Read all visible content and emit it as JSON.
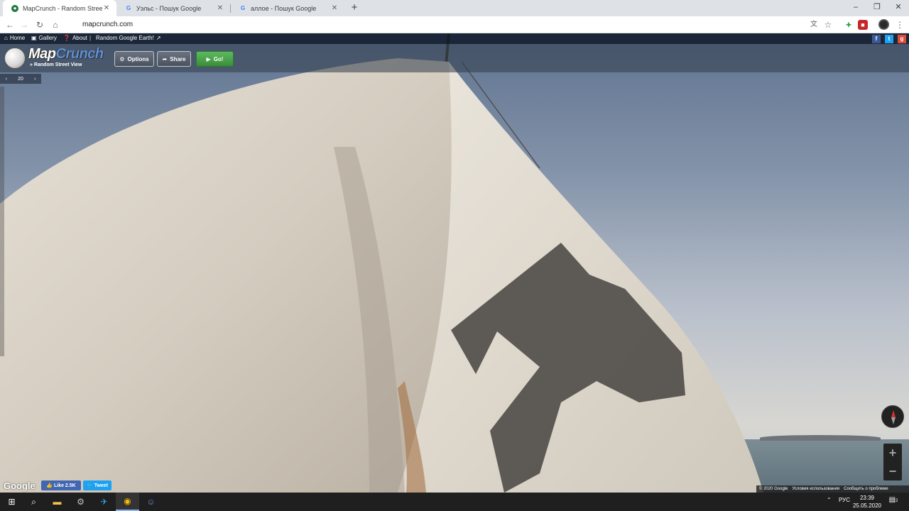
{
  "browser": {
    "tabs": [
      {
        "title": "MapCrunch - Random Street View",
        "active": true,
        "favicon": "mapcrunch-globe-icon"
      },
      {
        "title": "Уэльс - Пошук Google",
        "active": false,
        "favicon": "google-g-icon"
      },
      {
        "title": "аллое - Пошук Google",
        "active": false,
        "favicon": "google-g-icon"
      }
    ],
    "new_tab": "+",
    "window_controls": [
      "–",
      "❐",
      "✕"
    ],
    "url": "mapcrunch.com"
  },
  "site": {
    "nav": {
      "home": "Home",
      "gallery": "Gallery",
      "about": "About",
      "separator": "|",
      "random_earth": "Random Google Earth!"
    },
    "logo": {
      "map": "Map",
      "crunch": "Crunch",
      "subtitle": "» Random Street View"
    },
    "buttons": {
      "options": "Options",
      "share": "Share",
      "go": "Go!"
    },
    "zoom_value": "20",
    "google_logo": "Google",
    "fb_like": "Like 2.5K",
    "tweet": "Tweet",
    "attribution": {
      "copyright": "© 2020 Google",
      "terms": "Условия использования",
      "report": "Сообщить о проблеме"
    }
  },
  "taskbar": {
    "lang": "РУС",
    "time": "23:39",
    "date": "25.05.2020",
    "notifications": "2"
  },
  "colors": {
    "chrome_tabstrip": "#dee1e6",
    "taskbar": "#1f1f1f",
    "go_button": "#3a8f3a",
    "facebook": "#4267b2",
    "twitter": "#1da1f2"
  }
}
